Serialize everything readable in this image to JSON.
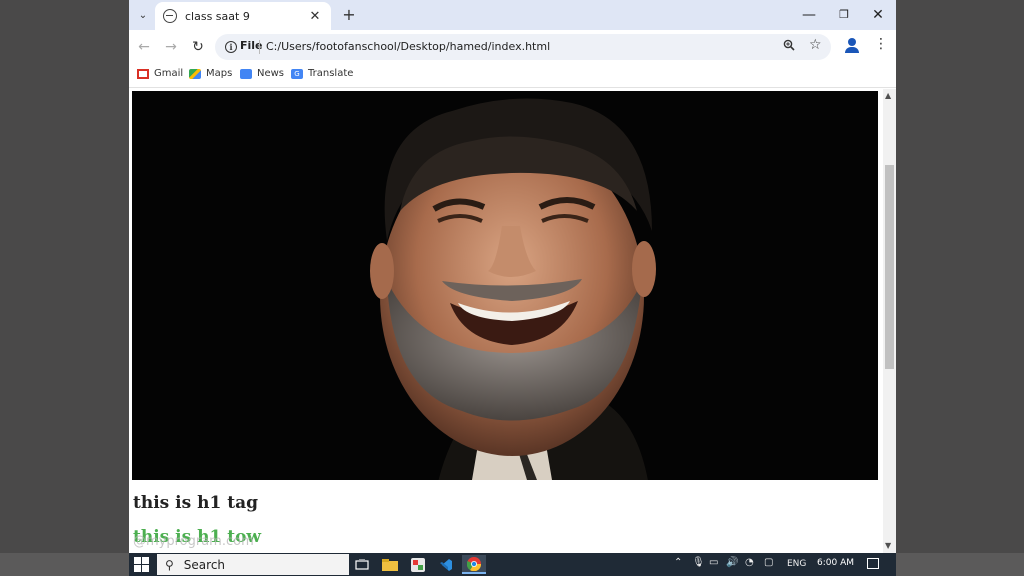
{
  "browser": {
    "tab_title": "class saat 9",
    "close_tab_glyph": "✕",
    "new_tab_glyph": "+",
    "tab_search_glyph": "⌄",
    "window_controls": {
      "minimize": "—",
      "maximize": "❐",
      "close": "✕"
    },
    "nav": {
      "back": "←",
      "forward": "→",
      "reload": "↻"
    },
    "address": {
      "scheme_label": "File",
      "url": "C:/Users/footofanschool/Desktop/hamed/index.html"
    },
    "toolbar_icons": {
      "zoom": "zoom-icon",
      "bookmark": "star-icon",
      "profile": "profile-icon",
      "menu": "menu-icon"
    },
    "bookmarks": [
      {
        "label": "Gmail",
        "icon": "gmail-icon"
      },
      {
        "label": "Maps",
        "icon": "maps-icon"
      },
      {
        "label": "News",
        "icon": "news-icon"
      },
      {
        "label": "Translate",
        "icon": "translate-icon"
      }
    ]
  },
  "page": {
    "heading_1": "this is h1 tag",
    "heading_2": "this is h1 tow",
    "heading_2_color": "#4caf50",
    "watermark": "@myprogram.com",
    "scroll_position": 0.14
  },
  "taskbar": {
    "search_placeholder": "Search",
    "language": "ENG",
    "time": "6:00 AM"
  }
}
